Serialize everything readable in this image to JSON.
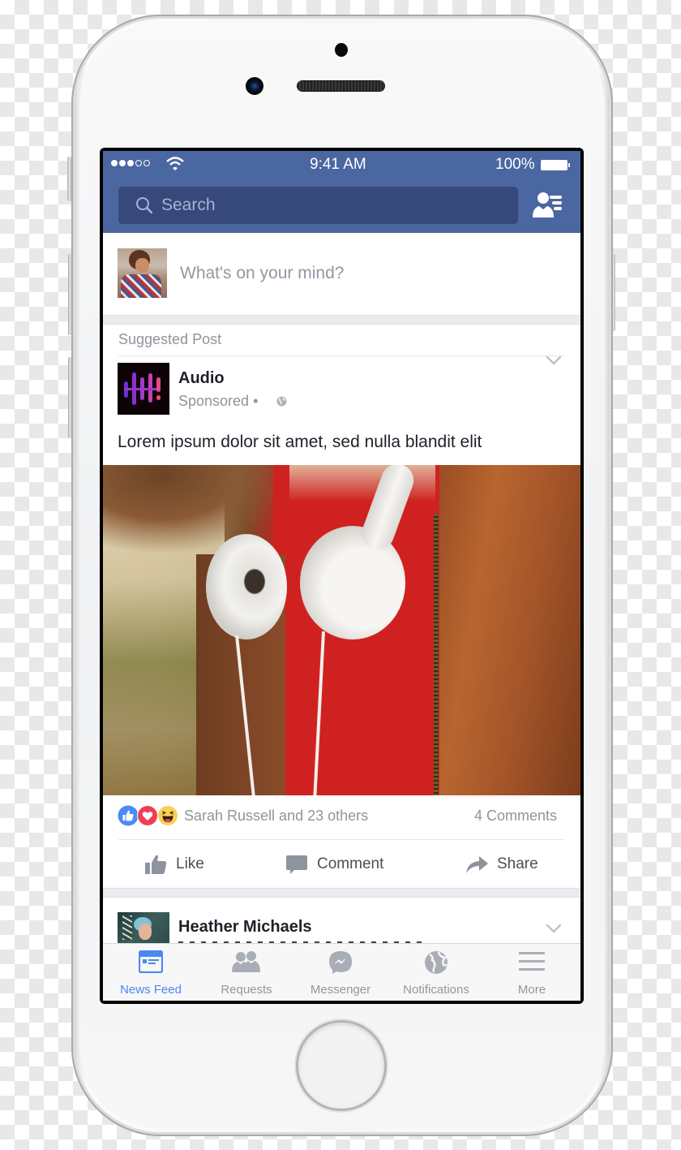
{
  "status_bar": {
    "signal_bars_filled": 3,
    "signal_bars_total": 5,
    "time": "9:41 AM",
    "battery": "100%"
  },
  "header": {
    "search_placeholder": "Search",
    "friend_requests_icon": "person-list-icon",
    "brand_color": "#4b67a1"
  },
  "composer": {
    "placeholder": "What's on your mind?"
  },
  "suggested_post": {
    "label": "Suggested Post",
    "page_name": "Audio",
    "meta": "Sponsored •",
    "privacy_icon": "globe-icon",
    "text": "Lorem ipsum dolor sit amet, sed nulla blandit elit",
    "image_alt": "Person wearing white headphones around neck, red sweater and brown leather jacket",
    "reactions": {
      "icons": [
        "like",
        "love",
        "haha"
      ],
      "summary": "Sarah Russell and 23 others",
      "comments": "4 Comments"
    },
    "actions": [
      {
        "label": "Like",
        "icon": "thumbs-up-icon"
      },
      {
        "label": "Comment",
        "icon": "comment-bubble-icon"
      },
      {
        "label": "Share",
        "icon": "share-arrow-icon"
      }
    ]
  },
  "next_post": {
    "author": "Heather Michaels"
  },
  "tabbar": {
    "active_color": "#4b88f1",
    "items": [
      {
        "label": "News Feed",
        "icon": "news-feed-icon",
        "active": true
      },
      {
        "label": "Requests",
        "icon": "friends-icon",
        "active": false
      },
      {
        "label": "Messenger",
        "icon": "messenger-icon",
        "active": false
      },
      {
        "label": "Notifications",
        "icon": "globe-icon",
        "active": false
      },
      {
        "label": "More",
        "icon": "hamburger-icon",
        "active": false
      }
    ]
  }
}
